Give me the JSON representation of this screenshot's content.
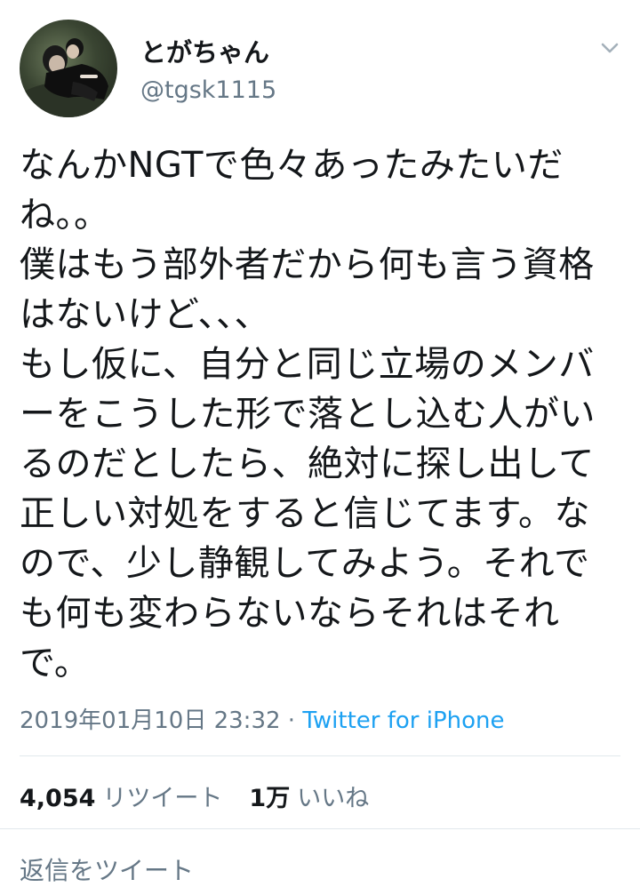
{
  "user": {
    "display_name": "とがちゃん",
    "handle": "@tgsk1115"
  },
  "tweet": {
    "text": "なんかNGTで色々あったみたいだね。。\n僕はもう部外者だから何も言う資格はないけど、、、\nもし仮に、自分と同じ立場のメンバーをこうした形で落とし込む人がいるのだとしたら、絶対に探し出して正しい対処をすると信じてます。なので、少し静観してみよう。それでも何も変わらないならそれはそれで。",
    "timestamp": "2019年01月10日 23:32",
    "separator": "·",
    "source": "Twitter for iPhone"
  },
  "stats": {
    "retweets_count": "4,054",
    "retweets_label": "リツイート",
    "likes_count": "1万",
    "likes_label": "いいね"
  },
  "reply": {
    "placeholder": "返信をツイート"
  },
  "colors": {
    "text": "#14171a",
    "secondary": "#657786",
    "link": "#1da1f2",
    "divider": "#e1e8ed"
  },
  "icons": {
    "menu": "chevron-down-icon"
  }
}
